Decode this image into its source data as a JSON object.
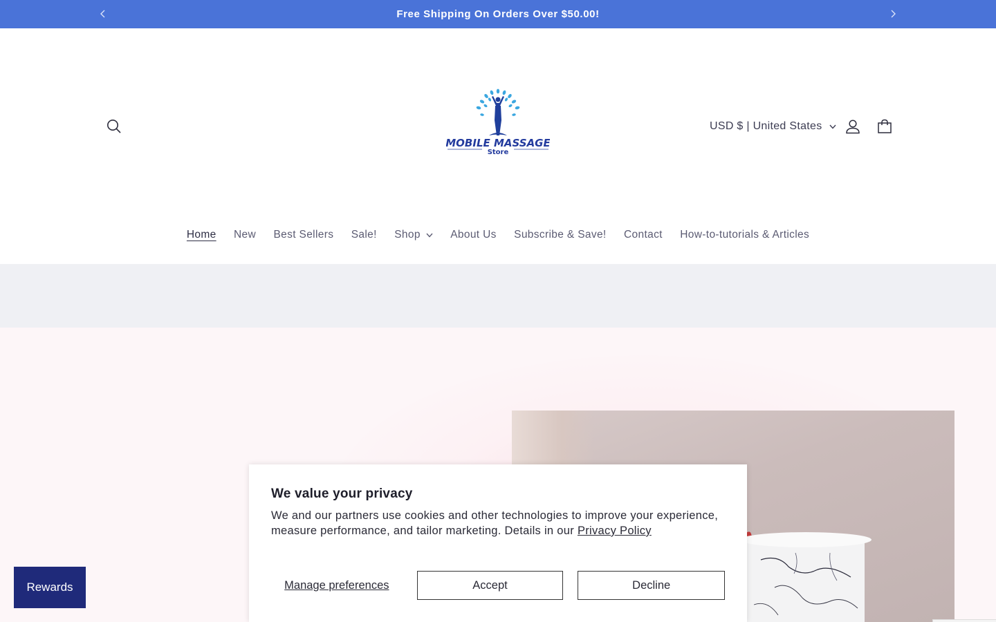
{
  "announcement": {
    "text": "Free Shipping On Orders Over $50.00!",
    "prev_icon": "chevron-left-icon",
    "next_icon": "chevron-right-icon",
    "background": "#4a73d8"
  },
  "header": {
    "logo": {
      "line1": "MOBILE MASSAGE",
      "line2": "Store"
    },
    "currency_label": "USD $ | United States",
    "icons": [
      "search-icon",
      "account-icon",
      "cart-icon"
    ]
  },
  "nav": {
    "items": [
      {
        "label": "Home",
        "active": true
      },
      {
        "label": "New"
      },
      {
        "label": "Best Sellers"
      },
      {
        "label": "Sale!"
      },
      {
        "label": "Shop",
        "has_dropdown": true
      },
      {
        "label": "About Us"
      },
      {
        "label": "Subscribe & Save!"
      },
      {
        "label": "Contact"
      },
      {
        "label": "How-to-tutorials & Articles"
      }
    ]
  },
  "rewards": {
    "label": "Rewards",
    "background": "#1f2a7a"
  },
  "cookie_banner": {
    "title": "We value your privacy",
    "body": "We and our partners use cookies and other technologies to improve your experience, measure performance, and tailor marketing. Details in our ",
    "privacy_link": "Privacy Policy",
    "body_end": "",
    "manage_label": "Manage preferences",
    "accept_label": "Accept",
    "decline_label": "Decline"
  }
}
